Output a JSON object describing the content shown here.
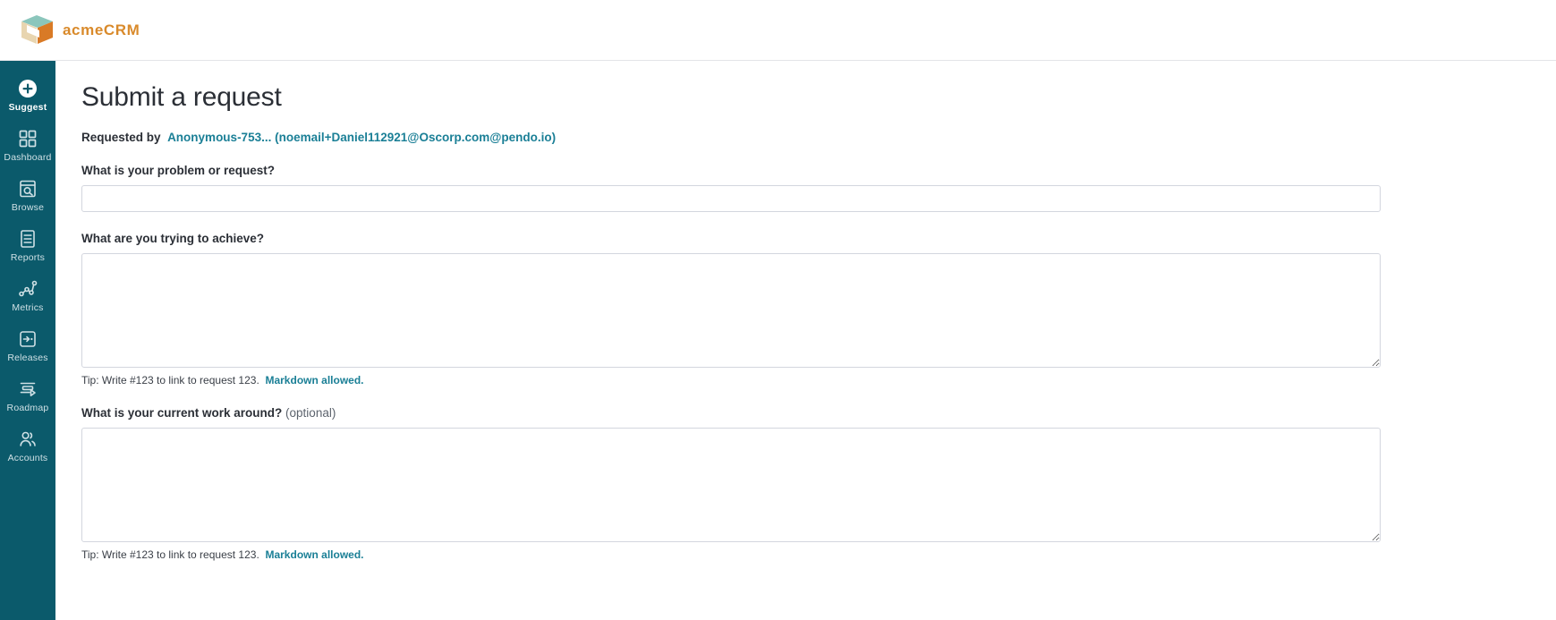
{
  "brand": {
    "name": "acmeCRM",
    "logo_icon": "cube-logo-icon",
    "logo_colors": {
      "top": "#8bc6bc",
      "left": "#e8d5b0",
      "right": "#d97a26"
    }
  },
  "sidebar": {
    "background": "#0b5a6b",
    "items": [
      {
        "label": "Suggest",
        "icon": "plus-circle-icon",
        "active": true
      },
      {
        "label": "Dashboard",
        "icon": "grid-squares-icon",
        "active": false
      },
      {
        "label": "Browse",
        "icon": "document-search-icon",
        "active": false
      },
      {
        "label": "Reports",
        "icon": "report-lines-icon",
        "active": false
      },
      {
        "label": "Metrics",
        "icon": "line-chart-nodes-icon",
        "active": false
      },
      {
        "label": "Releases",
        "icon": "arrow-into-box-icon",
        "active": false
      },
      {
        "label": "Roadmap",
        "icon": "roadmap-lines-icon",
        "active": false
      },
      {
        "label": "Accounts",
        "icon": "people-icon",
        "active": false
      }
    ]
  },
  "main": {
    "page_title": "Submit a request",
    "requested_by": {
      "label": "Requested by",
      "user": "Anonymous-753... (noemail+Daniel112921@Oscorp.com@pendo.io)"
    },
    "fields": [
      {
        "label": "What is your problem or request?",
        "optional_suffix": "",
        "type": "input",
        "value": "",
        "placeholder": ""
      },
      {
        "label": "What are you trying to achieve?",
        "optional_suffix": "",
        "type": "textarea",
        "value": "",
        "placeholder": "",
        "hint_text": "Tip: Write #123 to link to request 123.",
        "hint_link": "Markdown allowed."
      },
      {
        "label": "What is your current work around?",
        "optional_suffix": "(optional)",
        "type": "textarea",
        "value": "",
        "placeholder": "",
        "hint_text": "Tip: Write #123 to link to request 123.",
        "hint_link": "Markdown allowed."
      }
    ]
  },
  "colors": {
    "accent_teal": "#1a7f96",
    "sidebar_bg": "#0b5a6b",
    "brand_orange": "#d98a2b",
    "text_dark": "#2b2f36",
    "border": "#d3d6de"
  }
}
